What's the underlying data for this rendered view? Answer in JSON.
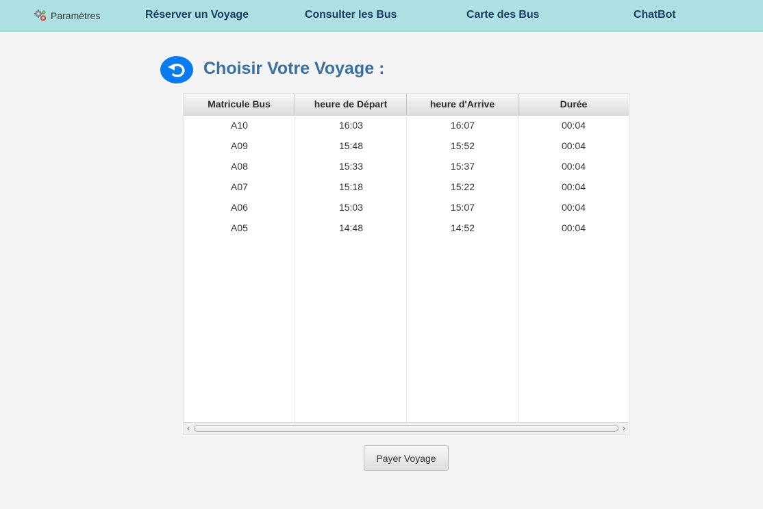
{
  "topbar": {
    "settings_label": "Paramètres",
    "settings_icon": "gears-icon",
    "nav": [
      "Réserver un Voyage",
      "Consulter les Bus",
      "Carte des Bus",
      "ChatBot"
    ],
    "background": "#ace0e3",
    "nav_color": "#1f3d64"
  },
  "page": {
    "title": "Choisir Votre Voyage :",
    "back_icon": "undo-arrow-icon",
    "accent": "#0a7cf0",
    "title_color": "#3a6f9f"
  },
  "table": {
    "columns": [
      "Matricule Bus",
      "heure de Départ",
      "heure d'Arrive",
      "Durée"
    ],
    "rows": [
      [
        "A10",
        "16:03",
        "16:07",
        "00:04"
      ],
      [
        "A09",
        "15:48",
        "15:52",
        "00:04"
      ],
      [
        "A08",
        "15:33",
        "15:37",
        "00:04"
      ],
      [
        "A07",
        "15:18",
        "15:22",
        "00:04"
      ],
      [
        "A06",
        "15:03",
        "15:07",
        "00:04"
      ],
      [
        "A05",
        "14:48",
        "14:52",
        "00:04"
      ]
    ],
    "scroll_left_icon": "chevron-left-icon",
    "scroll_right_icon": "chevron-right-icon"
  },
  "actions": {
    "pay_label": "Payer Voyage"
  }
}
